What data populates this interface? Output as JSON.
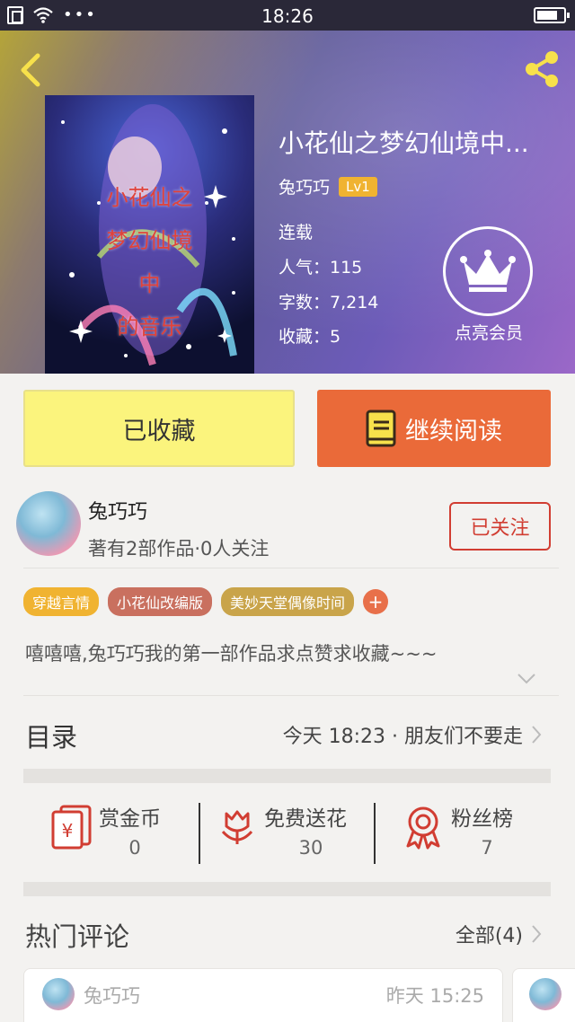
{
  "status_bar": {
    "time": "18:26",
    "dots": "•••"
  },
  "book": {
    "cover_title_lines": [
      "小花仙之",
      "梦幻仙境",
      "中",
      "的音乐"
    ],
    "title": "小花仙之梦幻仙境中...",
    "author": "兔巧巧",
    "level": "Lv1",
    "status": "连载",
    "popularity": "人气：115",
    "word_count": "字数：7,214",
    "favorites": "收藏：5"
  },
  "vip": {
    "label": "点亮会员"
  },
  "actions": {
    "collected_label": "已收藏",
    "read_label": "继续阅读"
  },
  "author_card": {
    "name": "兔巧巧",
    "stats": "著有2部作品·0人关注",
    "follow_label": "已关注"
  },
  "tags": [
    {
      "label": "穿越言情",
      "color": "#f0b331"
    },
    {
      "label": "小花仙改编版",
      "color": "#c9705f"
    },
    {
      "label": "美妙天堂偶像时间",
      "color": "#c9a44a"
    }
  ],
  "tag_add": "+",
  "description": "嘻嘻嘻,兔巧巧我的第一部作品求点赞求收藏~~~",
  "toc": {
    "label": "目录",
    "latest": "今天 18:23 · 朋友们不要走"
  },
  "stats": [
    {
      "label": "赏金币",
      "value": "0",
      "icon": "red-envelope-icon"
    },
    {
      "label": "免费送花",
      "value": "30",
      "icon": "flower-icon"
    },
    {
      "label": "粉丝榜",
      "value": "7",
      "icon": "medal-icon"
    }
  ],
  "comments_section": {
    "title": "热门评论",
    "all_label": "全部(4)"
  },
  "comments": [
    {
      "author": "兔巧巧",
      "time": "昨天 15:25"
    }
  ],
  "colors": {
    "accent_orange": "#ea6a39",
    "accent_yellow": "#fbf47d",
    "follow_red": "#d13d32",
    "icon_red": "#d13d32"
  }
}
